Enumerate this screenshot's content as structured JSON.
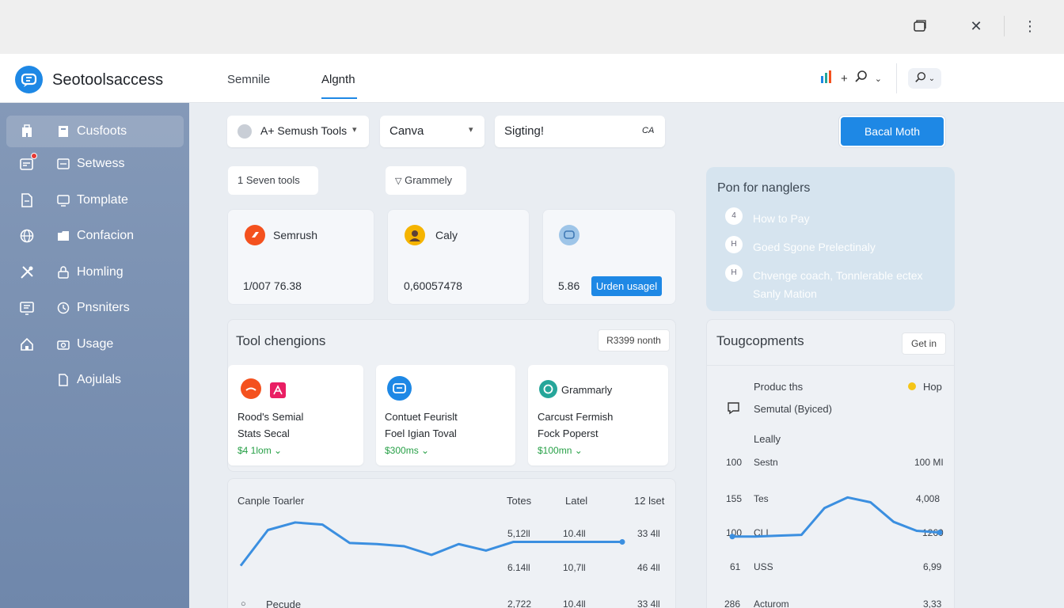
{
  "window": {
    "buttons": [
      {
        "name": "restore-window-icon",
        "glyph": "⧉"
      },
      {
        "name": "close-icon",
        "glyph": "✕"
      },
      {
        "name": "more-vertical-icon",
        "glyph": "⋮"
      }
    ]
  },
  "appbar": {
    "brand": "Seotoolsaccess",
    "tabs": [
      "Semnile",
      "Algnth"
    ],
    "active_tab": "Algnth",
    "icons": [
      "bar-chart-icon",
      "plus-icon",
      "search-icon",
      "chevron-down-icon"
    ]
  },
  "sidebar": {
    "items": [
      {
        "label": "Cusfoots",
        "outer_icon": "building-icon",
        "inner_icon": "document-icon",
        "active": true
      },
      {
        "label": "Setwess",
        "outer_icon": "calendar-icon",
        "inner_icon": "window-icon",
        "active": false,
        "badge": true
      },
      {
        "label": "Tomplate",
        "outer_icon": "file-icon",
        "inner_icon": "monitor-icon",
        "active": false
      },
      {
        "label": "Confacion",
        "outer_icon": "globe-icon",
        "inner_icon": "folder-icon",
        "active": false
      },
      {
        "label": "Homling",
        "outer_icon": "tools-icon",
        "inner_icon": "lock-icon",
        "active": false
      },
      {
        "label": "Pnsniters",
        "outer_icon": "grid-icon",
        "inner_icon": "clock-icon",
        "active": false
      },
      {
        "label": "Usage",
        "outer_icon": "home-icon",
        "inner_icon": "camera-icon",
        "active": false
      },
      {
        "label": "Aojulals",
        "outer_icon": "",
        "inner_icon": "page-icon",
        "active": false
      }
    ]
  },
  "toolbar": {
    "tools_select": "A+ Semush Tools",
    "app_select": "Canva",
    "search_value": "Sigting!",
    "search_suffix": "CA",
    "primary_button": "Bacal Moth"
  },
  "chips": [
    "1 Seven tools",
    "Grammely"
  ],
  "tool_cards": [
    {
      "name": "Semrush",
      "amount": "1/007 76.38",
      "icon_color": "#f4511e"
    },
    {
      "name": "Caly",
      "amount": "0,60057478",
      "icon_color": "#f5b400"
    },
    {
      "name": "",
      "amount": "5.86",
      "icon_color": "#9ec5e8",
      "button": "Urden usagel"
    }
  ],
  "tips_panel": {
    "title": "Pon for nanglers",
    "items": [
      {
        "num": "4",
        "text": "How to Pay"
      },
      {
        "num": "H",
        "text": "Goed Sgone Prelectinaly"
      },
      {
        "num": "H",
        "text": "Chvenge coach, Tonnlerable ectex Sanly Mation"
      }
    ]
  },
  "changes": {
    "title": "Tool chengions",
    "tag": "R3399 nonth",
    "cards": [
      {
        "line1": "Rood's Semial",
        "line2": "Stats Secal",
        "price": "$4 1lom",
        "icon_color": "#f4511e"
      },
      {
        "line1": "Contuet Feurislt",
        "line2": "Foel Igian Toval",
        "price": "$300ms",
        "icon_color": "#1e88e5"
      },
      {
        "line1": "Carcust Fermish",
        "line2": "Fock Poperst",
        "price": "$100mn",
        "icon_color": "#26a69a",
        "name": "Grammarly"
      }
    ]
  },
  "components": {
    "title": "Tougcopments",
    "button": "Get in",
    "header_left": "Produc ths",
    "header_right": "Hop",
    "row_label": "Semutal (Byiced)",
    "section": "Leally",
    "rows": [
      {
        "left": "100",
        "label": "Sestn",
        "right": "100 MI"
      },
      {
        "left": "155",
        "label": "Tes",
        "right": "4,008"
      },
      {
        "left": "100",
        "label": "CLI",
        "right": "1260"
      },
      {
        "left": "61",
        "label": "USS",
        "right": "6,99"
      },
      {
        "left": "286",
        "label": "Acturom",
        "right": "3,33"
      }
    ]
  },
  "sample": {
    "title": "Canple Toarler",
    "headers": [
      "Totes",
      "Latel",
      "12 lset"
    ],
    "rows": [
      [
        "5,12ll",
        "10.4ll",
        "33 4ll"
      ],
      [
        "6.14ll",
        "10,7ll",
        "46 4ll"
      ]
    ],
    "footer_label": "Pecude",
    "footer_values": [
      "2,722",
      "10.4ll",
      "33 4ll"
    ]
  },
  "chart_data": [
    {
      "type": "line",
      "values": [
        12,
        45,
        52,
        50,
        33,
        32,
        30,
        22,
        32,
        26,
        34,
        34,
        34,
        34,
        34
      ],
      "ylim": [
        0,
        60
      ]
    },
    {
      "type": "line",
      "values": [
        10,
        10,
        11,
        12,
        45,
        58,
        52,
        28,
        17,
        15
      ],
      "ylim": [
        0,
        70
      ]
    }
  ]
}
